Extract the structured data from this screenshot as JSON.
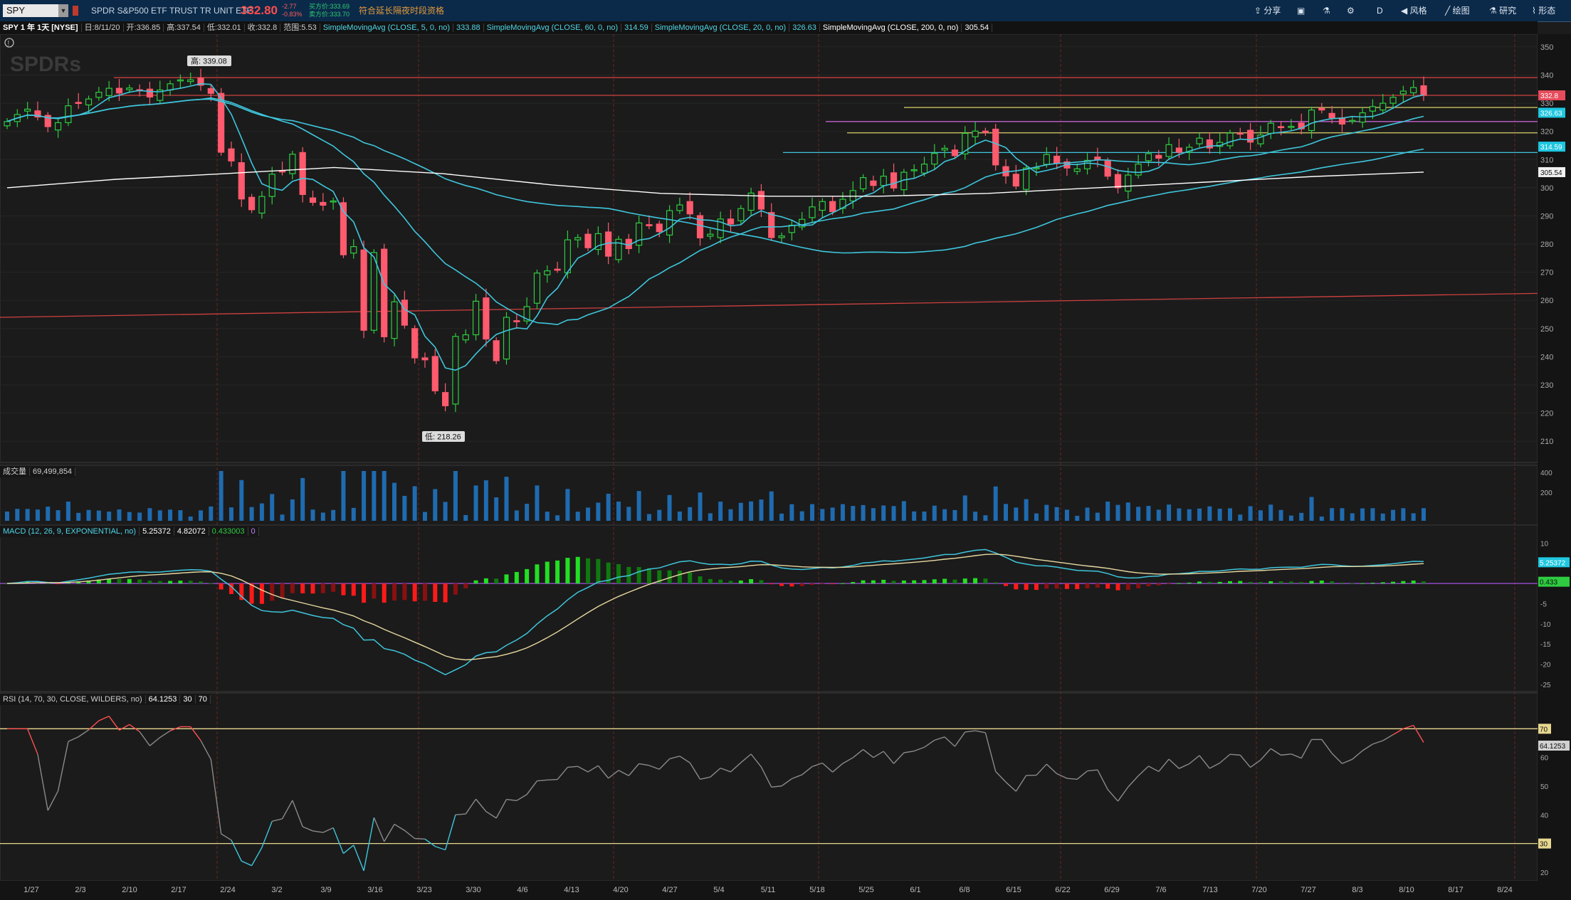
{
  "toolbar": {
    "symbol": "SPY",
    "description": "SPDR S&P500 ETF TRUST TR UNIT ETF",
    "last": "332.80",
    "change": "-2.77",
    "change_pct": "-0.83%",
    "bid": "买方价:333.69",
    "ask": "卖方价:333.70",
    "extended_hours": "符合延长隔夜时段资格",
    "buttons": [
      "分享",
      "风格",
      "绘图",
      "研究",
      "形态"
    ],
    "aggregation": "D"
  },
  "header": {
    "title": "SPY 1 年 1天 [NYSE]",
    "date": "日:8/11/20",
    "open": "开:336.85",
    "high": "高:337.54",
    "low": "低:332.01",
    "close": "收:332.8",
    "range": "范围:5.53",
    "studies": [
      {
        "label": "SimpleMovingAvg (CLOSE, 5, 0, no)",
        "value": "333.88",
        "color": "#4fd6e8"
      },
      {
        "label": "SimpleMovingAvg (CLOSE, 60, 0, no)",
        "value": "314.59",
        "color": "#4fd6e8"
      },
      {
        "label": "SimpleMovingAvg (CLOSE, 20, 0, no)",
        "value": "326.63",
        "color": "#4fd6e8"
      },
      {
        "label": "SimpleMovingAvg (CLOSE, 200, 0, no)",
        "value": "305.54",
        "color": "#ffffff"
      }
    ]
  },
  "watermark": "SPDRs",
  "annotations": {
    "high": "高: 339.08",
    "low": "低: 218.26"
  },
  "price_badges": [
    {
      "text": "332.8",
      "price": 332.8,
      "bg": "#e74c5c"
    },
    {
      "text": "326.63",
      "price": 326.63,
      "bg": "#1fc7e0"
    },
    {
      "text": "314.59",
      "price": 314.59,
      "bg": "#1fc7e0"
    },
    {
      "text": "305.54",
      "price": 305.54,
      "bg": "#f2f2f2"
    }
  ],
  "volume": {
    "label": "成交量",
    "value": "69,499,854",
    "ticks": [
      "400",
      "200"
    ]
  },
  "macd": {
    "label": "MACD (12, 26, 9, EXPONENTIAL, no)",
    "value": "5.25372",
    "avg": "4.82072",
    "diff": "0.433003",
    "zero": "0",
    "badges": [
      {
        "text": "5.25372",
        "value": 5.25372
      },
      {
        "text": "0.433",
        "value": 0.433
      }
    ],
    "ticks": [
      "10",
      "5",
      "0",
      "-5",
      "-10",
      "-15",
      "-20",
      "-25"
    ]
  },
  "rsi": {
    "label": "RSI (14, 70, 30, CLOSE, WILDERS, no)",
    "value": "64.1253",
    "ob": "30",
    "os": "70",
    "badges": [
      {
        "text": "70",
        "value": 70
      },
      {
        "text": "64.1253",
        "value": 64.1253
      },
      {
        "text": "30",
        "value": 30
      }
    ],
    "ticks": [
      "70",
      "60",
      "50",
      "40",
      "30",
      "20"
    ]
  },
  "price_ticks": [
    "350",
    "340",
    "330",
    "320",
    "310",
    "300",
    "290",
    "280",
    "270",
    "260",
    "250",
    "240",
    "230",
    "220",
    "210"
  ],
  "date_ticks": [
    "1/27",
    "2/3",
    "2/10",
    "2/17",
    "2/24",
    "3/2",
    "3/9",
    "3/16",
    "3/23",
    "3/30",
    "4/6",
    "4/13",
    "4/20",
    "4/27",
    "5/4",
    "5/11",
    "5/18",
    "5/25",
    "6/1",
    "6/8",
    "6/15",
    "6/22",
    "6/29",
    "7/6",
    "7/13",
    "7/20",
    "7/27",
    "8/3",
    "8/10",
    "8/17",
    "8/24"
  ],
  "chart_data": {
    "type": "candlestick",
    "title": "SPY 1 年 1天 [NYSE]",
    "ylim": [
      205,
      352
    ],
    "closes": [
      323.5,
      326.0,
      327.9,
      325.1,
      321.7,
      323.1,
      329.1,
      330.0,
      331.5,
      333.9,
      335.3,
      333.6,
      335.4,
      334.4,
      332.2,
      334.7,
      336.9,
      338.3,
      338.3,
      336.4,
      333.5,
      312.6,
      309.5,
      296.0,
      292.2,
      296.9,
      304.8,
      305.6,
      311.9,
      297.6,
      294.8,
      293.8,
      295.3,
      276.2,
      279.1,
      249.4,
      277.0,
      247.1,
      259.5,
      251.2,
      239.6,
      238.9,
      227.9,
      222.6,
      247.2,
      247.8,
      259.7,
      246.3,
      238.6,
      254.0,
      252.7,
      257.8,
      269.7,
      270.5,
      271.0,
      281.5,
      282.3,
      278.7,
      283.7,
      275.7,
      281.7,
      278.4,
      287.5,
      286.5,
      284.4,
      291.9,
      293.9,
      290.7,
      282.2,
      283.5,
      288.9,
      287.1,
      292.6,
      298.1,
      292.4,
      282.3,
      282.9,
      286.7,
      288.8,
      293.2,
      295.1,
      291.5,
      295.9,
      299.0,
      303.6,
      300.8,
      304.1,
      299.9,
      305.5,
      306.4,
      308.4,
      312.2,
      314.0,
      311.4,
      319.3,
      320.1,
      319.6,
      308.1,
      304.2,
      300.6,
      307.0,
      307.1,
      311.8,
      308.6,
      307.0,
      306.7,
      309.7,
      310.1,
      304.1,
      300.0,
      304.5,
      308.4,
      312.1,
      310.5,
      315.3,
      312.6,
      314.4,
      317.6,
      314.1,
      316.1,
      319.4,
      319.2,
      316.2,
      318.7,
      322.9,
      321.4,
      321.8,
      320.9,
      327.6,
      327.6,
      324.8,
      322.6,
      323.9,
      326.6,
      328.8,
      330.0,
      332.1,
      334.3,
      335.6,
      332.8
    ],
    "sma": [
      {
        "name": "SMA 5",
        "color": "#3ec6dc"
      },
      {
        "name": "SMA 20",
        "color": "#3ec6dc"
      },
      {
        "name": "SMA 60",
        "color": "#3ec6dc"
      },
      {
        "name": "SMA 200",
        "color": "#ffffff",
        "values": [
          300.0,
          303.0,
          305.0,
          307.2,
          305.0,
          301.0,
          298.0,
          297.0,
          297.0,
          298.0,
          300.0,
          302.0,
          304.0,
          305.54
        ]
      }
    ],
    "horizontal_lines": [
      {
        "price": 339.1,
        "color": "#d04040"
      },
      {
        "price": 332.8,
        "color": "#d04040"
      },
      {
        "price": 328.5,
        "color": "#c8c060"
      },
      {
        "price": 323.5,
        "color": "#c060d0"
      },
      {
        "price": 319.5,
        "color": "#c8c060"
      },
      {
        "price": 312.5,
        "color": "#3ec6dc"
      }
    ],
    "trendline": {
      "from": 254,
      "to": 262.5,
      "color": "#d04040"
    },
    "volume": [],
    "macd": [],
    "rsi": []
  }
}
